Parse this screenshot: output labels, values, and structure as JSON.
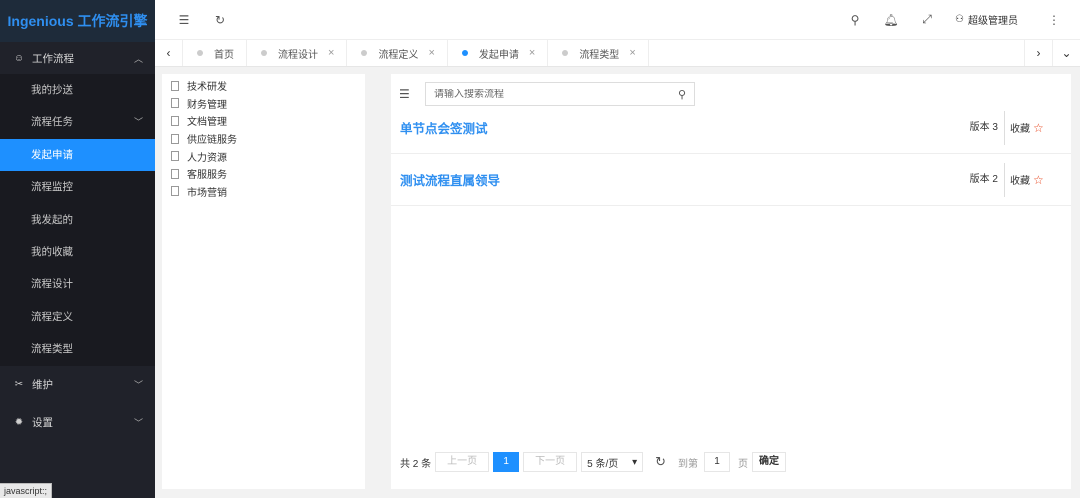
{
  "app": {
    "title": "Ingenious 工作流引擎"
  },
  "sidebar": {
    "groups": [
      {
        "label": "工作流程",
        "icon": "smile-icon",
        "expanded": true,
        "items": [
          {
            "label": "我的抄送"
          },
          {
            "label": "流程任务",
            "has_children": true
          },
          {
            "label": "发起申请",
            "active": true
          },
          {
            "label": "流程监控"
          },
          {
            "label": "我发起的"
          },
          {
            "label": "我的收藏"
          },
          {
            "label": "流程设计"
          },
          {
            "label": "流程定义"
          },
          {
            "label": "流程类型"
          }
        ]
      },
      {
        "label": "维护",
        "icon": "tools-icon",
        "expanded": false
      },
      {
        "label": "设置",
        "icon": "gear-icon",
        "expanded": false
      }
    ],
    "status_tip": "javascript:;"
  },
  "header": {
    "user_name": "超级管理员"
  },
  "tabs": [
    {
      "label": "首页",
      "closable": false
    },
    {
      "label": "流程设计",
      "closable": true
    },
    {
      "label": "流程定义",
      "closable": true
    },
    {
      "label": "发起申请",
      "closable": true,
      "active": true
    },
    {
      "label": "流程类型",
      "closable": true
    }
  ],
  "tree": {
    "items": [
      "技术研发",
      "财务管理",
      "文档管理",
      "供应链服务",
      "人力资源",
      "客服服务",
      "市场营销"
    ]
  },
  "main": {
    "search": {
      "placeholder": "请输入搜索流程",
      "value": ""
    },
    "processes": [
      {
        "title": "单节点会签测试",
        "version": "版本 3",
        "fav_label": "收藏"
      },
      {
        "title": "测试流程直属领导",
        "version": "版本 2",
        "fav_label": "收藏"
      }
    ],
    "pagination": {
      "total": "共 2 条",
      "prev": "上一页",
      "current": "1",
      "next": "下一页",
      "page_size": "5 条/页",
      "goto_label": "到第",
      "goto_value": "1",
      "page_unit": "页",
      "confirm": "确定"
    }
  },
  "colors": {
    "accent": "#1e90ff",
    "sidebar_bg": "#20222a",
    "star": "#e8461f"
  }
}
